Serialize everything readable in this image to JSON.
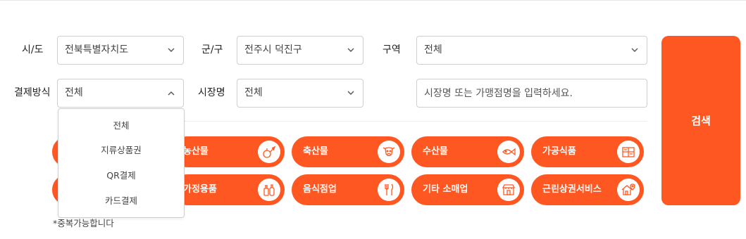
{
  "filters": {
    "sido": {
      "label": "시/도",
      "value": "전북특별자치도"
    },
    "gungu": {
      "label": "군/구",
      "value": "전주시 덕진구"
    },
    "area": {
      "label": "구역",
      "value": "전체"
    },
    "payment": {
      "label": "결제방식",
      "value": "전체"
    },
    "market": {
      "label": "시장명",
      "value": "전체"
    },
    "keyword": {
      "placeholder": "시장명 또는 가맹점명을 입력하세요."
    }
  },
  "search_button": "검색",
  "payment_options": [
    "전체",
    "지류상품권",
    "QR결제",
    "카드결제"
  ],
  "categories": {
    "row1": [
      {
        "label": "농산물",
        "icon": "vegetable-icon"
      },
      {
        "label": "축산물",
        "icon": "cow-icon"
      },
      {
        "label": "수산물",
        "icon": "fish-icon"
      },
      {
        "label": "가공식품",
        "icon": "processed-food-icon"
      }
    ],
    "row2": [
      {
        "label": "가정용품",
        "icon": "household-bottles-icon"
      },
      {
        "label": "음식점업",
        "icon": "fork-knife-icon"
      },
      {
        "label": "기타 소매업",
        "icon": "store-icon"
      },
      {
        "label": "근린상권서비스",
        "icon": "house-location-icon"
      }
    ]
  },
  "note": "*중복가능합니다",
  "colors": {
    "accent": "#ff5722",
    "border": "#cfcfcf"
  }
}
